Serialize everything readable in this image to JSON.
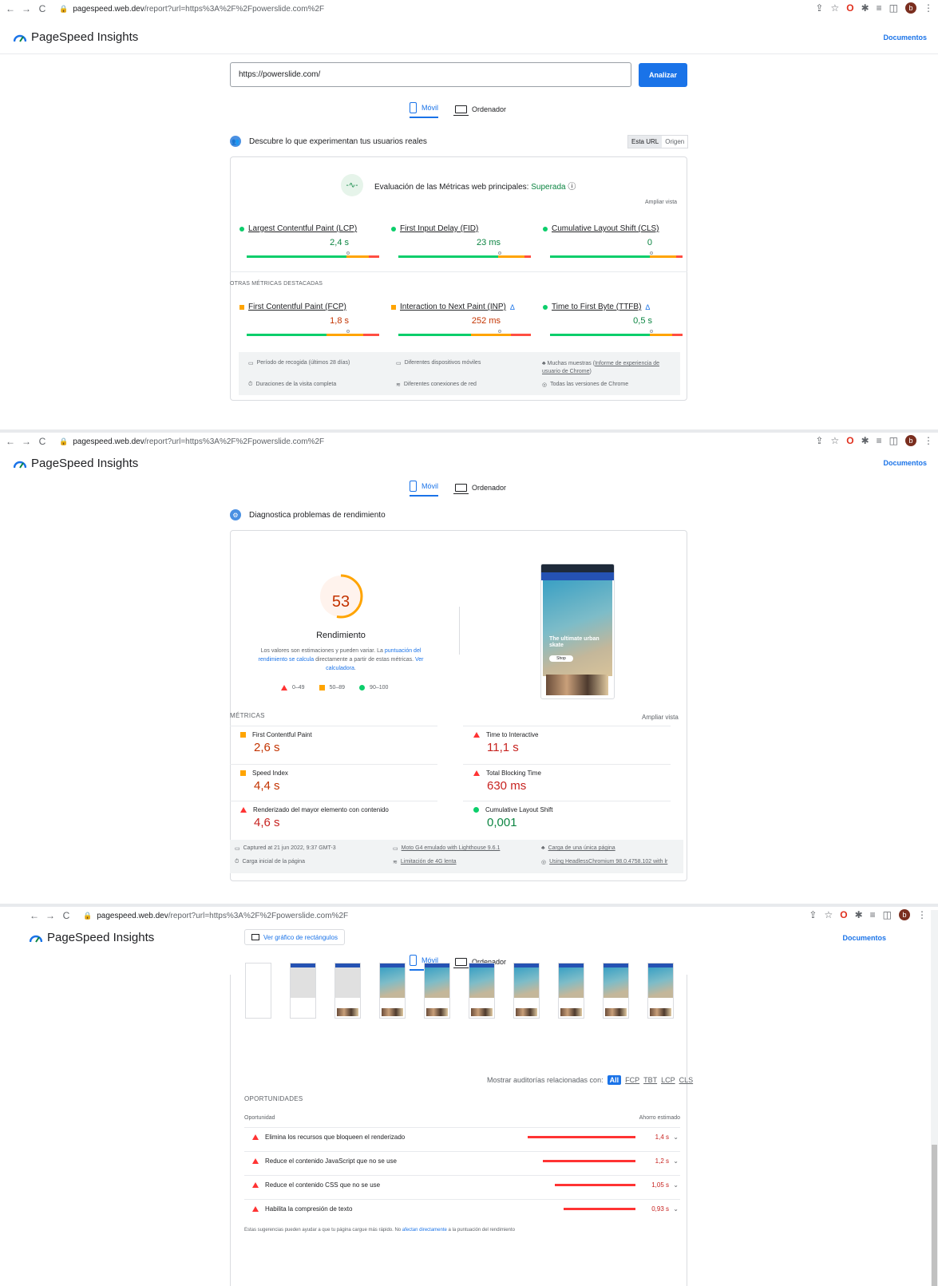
{
  "browser": {
    "back": "←",
    "forward": "→",
    "reload": "C",
    "url_host": "pagespeed.web.dev",
    "url_rest": "/report?url=https%3A%2F%2Fpowerslide.com%2F"
  },
  "app": {
    "title": "PageSpeed Insights",
    "docs_link": "Documentos"
  },
  "form": {
    "url_value": "https://powerslide.com/",
    "analyze_label": "Analizar"
  },
  "tabs": {
    "mobile": "Móvil",
    "desktop": "Ordenador"
  },
  "field_data": {
    "heading": "Descubre lo que experimentan tus usuarios reales",
    "toggle": {
      "this_url": "Esta URL",
      "origin": "Origen"
    },
    "assessment_prefix": "Evaluación de las Métricas web principales: ",
    "assessment_result": "Superada",
    "expand_label": "Ampliar vista",
    "core_metrics": [
      {
        "label": "Largest Contentful Paint (LCP)",
        "value": "2,4 s",
        "status": "good",
        "marker_fraction": 0.75
      },
      {
        "label": "First Input Delay (FID)",
        "value": "23 ms",
        "status": "good",
        "marker_fraction": 0.75
      },
      {
        "label": "Cumulative Layout Shift (CLS)",
        "value": "0",
        "status": "good",
        "marker_fraction": 0.75
      }
    ],
    "other_heading": "OTRAS MÉTRICAS DESTACADAS",
    "other_metrics": [
      {
        "label": "First Contentful Paint (FCP)",
        "value": "1,8 s",
        "status": "average",
        "marker_fraction": 0.75,
        "delta": ""
      },
      {
        "label": "Interaction to Next Paint (INP)",
        "value": "252 ms",
        "status": "average",
        "marker_fraction": 0.75,
        "delta": "Δ"
      },
      {
        "label": "Time to First Byte (TTFB)",
        "value": "0,5 s",
        "status": "good",
        "marker_fraction": 0.75,
        "delta": "Δ"
      }
    ],
    "footer": {
      "period": "Período de recogida (últimos 28 días)",
      "devices": "Diferentes dispositivos móviles",
      "samples_prefix": "Muchas muestras (",
      "samples_link": "Informe de experiencia de usuario de Chrome",
      "samples_suffix": ")",
      "durations": "Duraciones de la visita completa",
      "network": "Diferentes conexiones de red",
      "versions": "Todas las versiones de Chrome"
    }
  },
  "lab": {
    "heading": "Diagnostica problemas de rendimiento",
    "score": "53",
    "score_fraction": 0.53,
    "score_title": "Rendimiento",
    "note_1": "Los valores son estimaciones y pueden variar. La ",
    "note_link_1": "puntuación del rendimiento se calcula",
    "note_2": " directamente a partir de estas métricas. ",
    "note_link_2": "Ver calculadora",
    "note_3": ".",
    "legend": {
      "bad": "0–49",
      "avg": "50–89",
      "good": "90–100"
    },
    "screenshot": {
      "hero_text": "The ultimate urban skate",
      "shop": "Shop"
    },
    "metrics_heading": "MÉTRICAS",
    "expand_label": "Ampliar vista",
    "metrics": [
      {
        "label": "First Contentful Paint",
        "value": "2,6 s",
        "status": "average"
      },
      {
        "label": "Time to Interactive",
        "value": "11,1 s",
        "status": "bad"
      },
      {
        "label": "Speed Index",
        "value": "4,4 s",
        "status": "average"
      },
      {
        "label": "Total Blocking Time",
        "value": "630 ms",
        "status": "bad"
      },
      {
        "label": "Renderizado del mayor elemento con contenido",
        "value": "4,6 s",
        "status": "bad"
      },
      {
        "label": "Cumulative Layout Shift",
        "value": "0,001",
        "status": "good"
      }
    ],
    "footer": {
      "captured": "Captured at 21 jun 2022, 9:37 GMT-3",
      "device": "Moto G4 emulado with Lighthouse 9.6.1",
      "single_page": "Carga de una única página",
      "initial_load": "Carga inicial de la página",
      "throttling": "Limitación de 4G lenta",
      "browser": "Using HeadlessChromium 98.0.4758.102 with lr"
    }
  },
  "opportunities": {
    "treemap_label": "Ver gráfico de rectángulos",
    "filter_prefix": "Mostrar auditorías relacionadas con:",
    "filters": [
      "All",
      "FCP",
      "TBT",
      "LCP",
      "CLS"
    ],
    "heading": "OPORTUNIDADES",
    "col_opportunity": "Oportunidad",
    "col_savings": "Ahorro estimado",
    "items": [
      {
        "label": "Elimina los recursos que bloqueen el renderizado",
        "savings": "1,4 s",
        "savings_seconds": 1.4
      },
      {
        "label": "Reduce el contenido JavaScript que no se use",
        "savings": "1,2 s",
        "savings_seconds": 1.2
      },
      {
        "label": "Reduce el contenido CSS que no se use",
        "savings": "1,05 s",
        "savings_seconds": 1.05
      },
      {
        "label": "Habilita la compresión de texto",
        "savings": "0,93 s",
        "savings_seconds": 0.93
      }
    ],
    "note_prefix": "Estas sugerencias pueden ayudar a que tu página cargue más rápido. No ",
    "note_link": "afectan directamente",
    "note_suffix": " a la puntuación del rendimiento"
  },
  "colors": {
    "accent": "#1a73e8",
    "good": "#0cce6b",
    "average": "#ffa400",
    "bad": "#ff4e42"
  }
}
